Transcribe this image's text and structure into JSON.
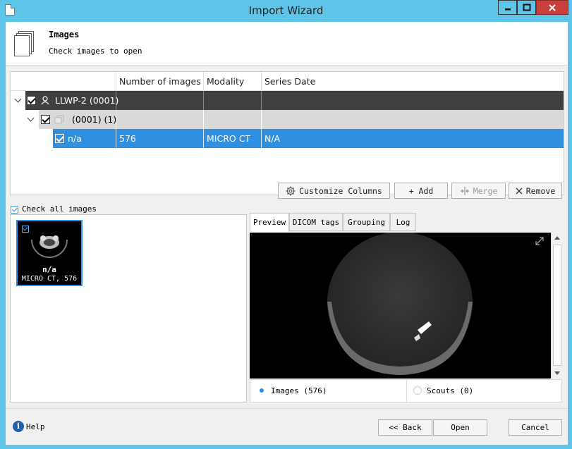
{
  "window": {
    "title": "Import Wizard"
  },
  "header": {
    "title": "Images",
    "subtitle": "Check images to open"
  },
  "tree": {
    "columns": [
      "",
      "Number of images",
      "Modality",
      "Series Date"
    ],
    "rows": [
      {
        "label": "LLWP-2 (0001)",
        "number": "",
        "modality": "",
        "date": ""
      },
      {
        "label": "(0001) (1)",
        "number": "",
        "modality": "",
        "date": ""
      },
      {
        "label": "n/a",
        "number": "576",
        "modality": "MICRO CT",
        "date": "N/A"
      }
    ]
  },
  "toolbar": {
    "customize_label": "Customize Columns",
    "add_label": "+ Add",
    "merge_label": "Merge",
    "remove_label": "Remove"
  },
  "check_all_label": "Check all images",
  "thumbnail": {
    "name": "n/a",
    "info": "MICRO CT, 576"
  },
  "preview_tabs": [
    "Preview",
    "DICOM tags",
    "Grouping",
    "Log"
  ],
  "image_filter": {
    "images_label": "Images (576)",
    "scouts_label": "Scouts (0)"
  },
  "footer": {
    "help_label": "Help",
    "back_label": "<< Back",
    "open_label": "Open",
    "cancel_label": "Cancel"
  },
  "colors": {
    "accent": "#2f8fe0",
    "titlebar": "#5ec4e8",
    "close": "#c7413a",
    "dark_row": "#404040",
    "mid_row": "#d9d9d9"
  }
}
